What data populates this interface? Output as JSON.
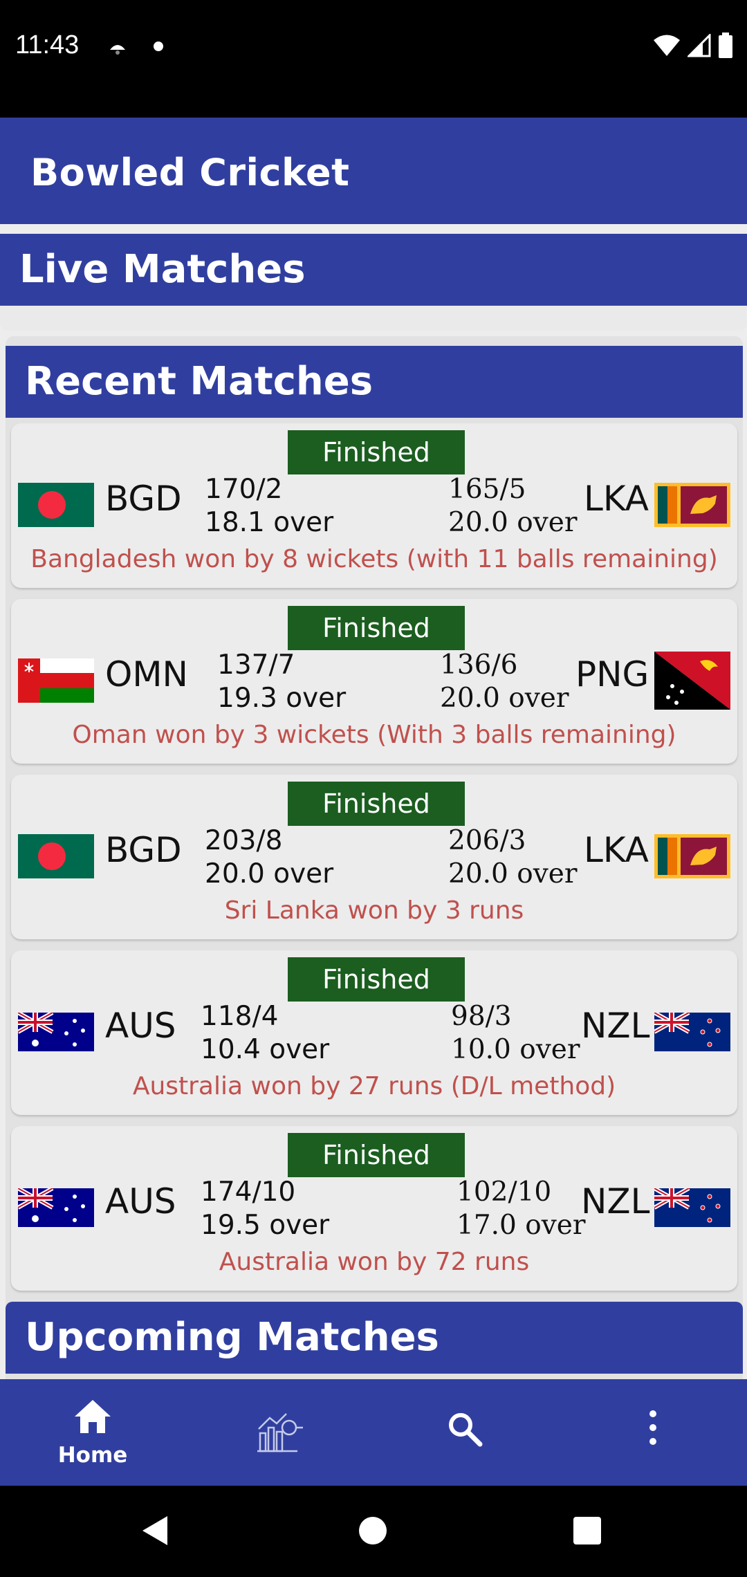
{
  "status_bar": {
    "time": "11:43"
  },
  "app_bar": {
    "title": "Bowled Cricket"
  },
  "sections": {
    "live": "Live Matches",
    "recent": "Recent Matches",
    "upcoming": "Upcoming Matches"
  },
  "matches": [
    {
      "status": "Finished",
      "team1": {
        "code": "BGD",
        "flag": "bangladesh-flag",
        "score": "170/2",
        "overs": "18.1 over"
      },
      "team2": {
        "code": "LKA",
        "flag": "sri-lanka-flag",
        "score": "165/5",
        "overs": "20.0 over"
      },
      "result": "Bangladesh won by 8 wickets (with 11 balls remaining)"
    },
    {
      "status": "Finished",
      "team1": {
        "code": "OMN",
        "flag": "oman-flag",
        "score": "137/7",
        "overs": "19.3 over"
      },
      "team2": {
        "code": "PNG",
        "flag": "papua-new-guinea-flag",
        "score": "136/6",
        "overs": "20.0 over"
      },
      "result": "Oman won by 3 wickets (With 3 balls remaining)"
    },
    {
      "status": "Finished",
      "team1": {
        "code": "BGD",
        "flag": "bangladesh-flag",
        "score": "203/8",
        "overs": "20.0 over"
      },
      "team2": {
        "code": "LKA",
        "flag": "sri-lanka-flag",
        "score": "206/3",
        "overs": "20.0 over"
      },
      "result": "Sri Lanka won by 3 runs"
    },
    {
      "status": "Finished",
      "team1": {
        "code": "AUS",
        "flag": "australia-flag",
        "score": "118/4",
        "overs": "10.4 over"
      },
      "team2": {
        "code": "NZL",
        "flag": "new-zealand-flag",
        "score": "98/3",
        "overs": "10.0 over"
      },
      "result": "Australia won by 27 runs (D/L method)"
    },
    {
      "status": "Finished",
      "team1": {
        "code": "AUS",
        "flag": "australia-flag",
        "score": "174/10",
        "overs": "19.5 over"
      },
      "team2": {
        "code": "NZL",
        "flag": "new-zealand-flag",
        "score": "102/10",
        "overs": "17.0 over"
      },
      "result": "Australia won by 72 runs"
    }
  ],
  "bottom_nav": {
    "home_label": "Home",
    "items": [
      "home-icon",
      "stats-icon",
      "search-icon",
      "more-icon"
    ]
  },
  "colors": {
    "primary": "#303f9f",
    "status_finished": "#1b5e20",
    "result_text": "#c0504d"
  }
}
